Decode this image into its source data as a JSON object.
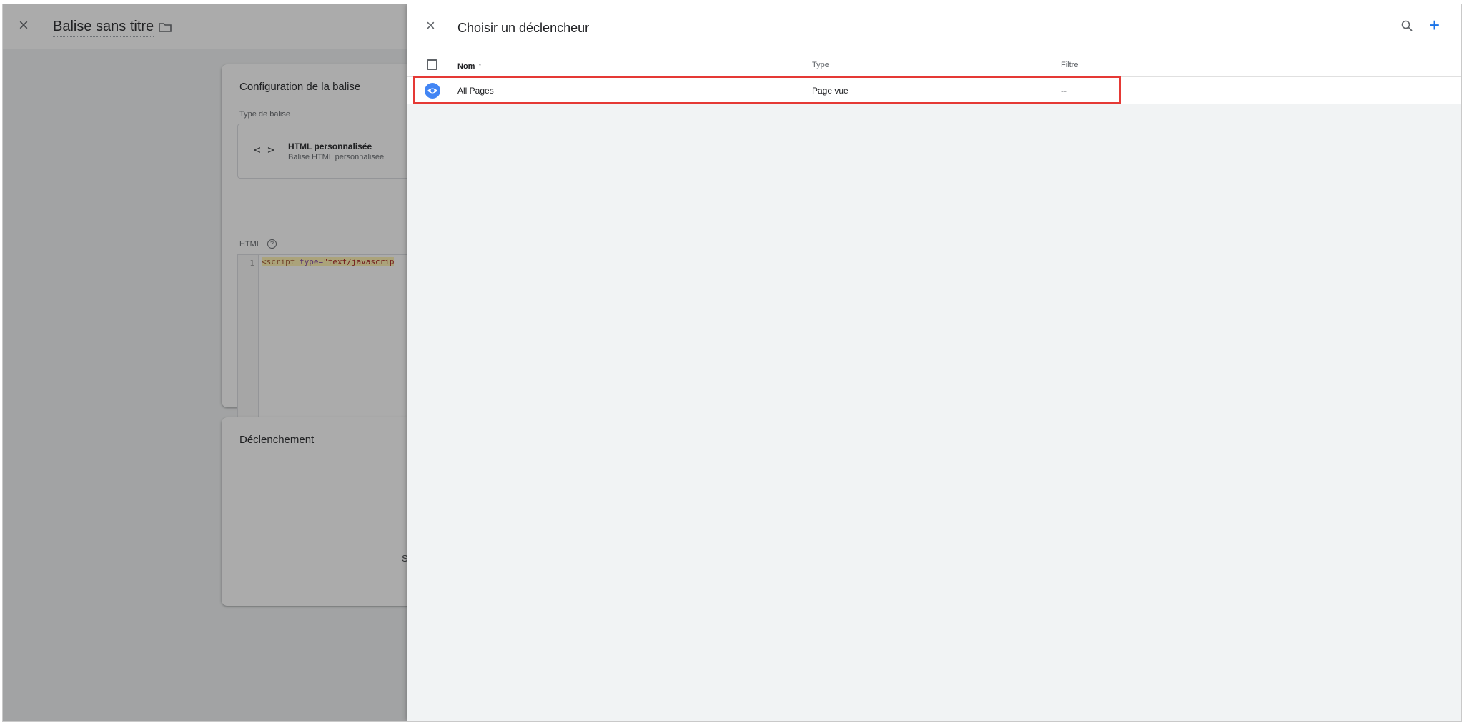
{
  "background": {
    "header": {
      "title": "Balise sans titre"
    },
    "config_card": {
      "title": "Configuration de la balise",
      "tag_type_label": "Type de balise",
      "tag_type_name": "HTML personnalisée",
      "tag_type_sub": "Balise HTML personnalisée",
      "html_label": "HTML",
      "code": {
        "line_number": "1",
        "open": "<",
        "tag": "script",
        "attr": " type=",
        "value": "\"text/javascrip"
      }
    },
    "trigger_card": {
      "title": "Déclenchement",
      "partial_text": "S"
    }
  },
  "drawer": {
    "title": "Choisir un déclencheur",
    "columns": {
      "name": "Nom",
      "type": "Type",
      "filter": "Filtre"
    },
    "rows": [
      {
        "name": "All Pages",
        "type": "Page vue",
        "filter": "--"
      }
    ]
  },
  "colors": {
    "accent": "#1a73e8",
    "trigger_badge": "#4285f4",
    "highlight": "#e53935"
  },
  "icons": {
    "close": "close-icon",
    "folder": "folder-icon",
    "search": "search-icon",
    "add": "plus-icon",
    "sort": "arrow-up-icon",
    "trigger": "eye-icon",
    "code": "code-brackets-icon",
    "help": "help-icon"
  }
}
